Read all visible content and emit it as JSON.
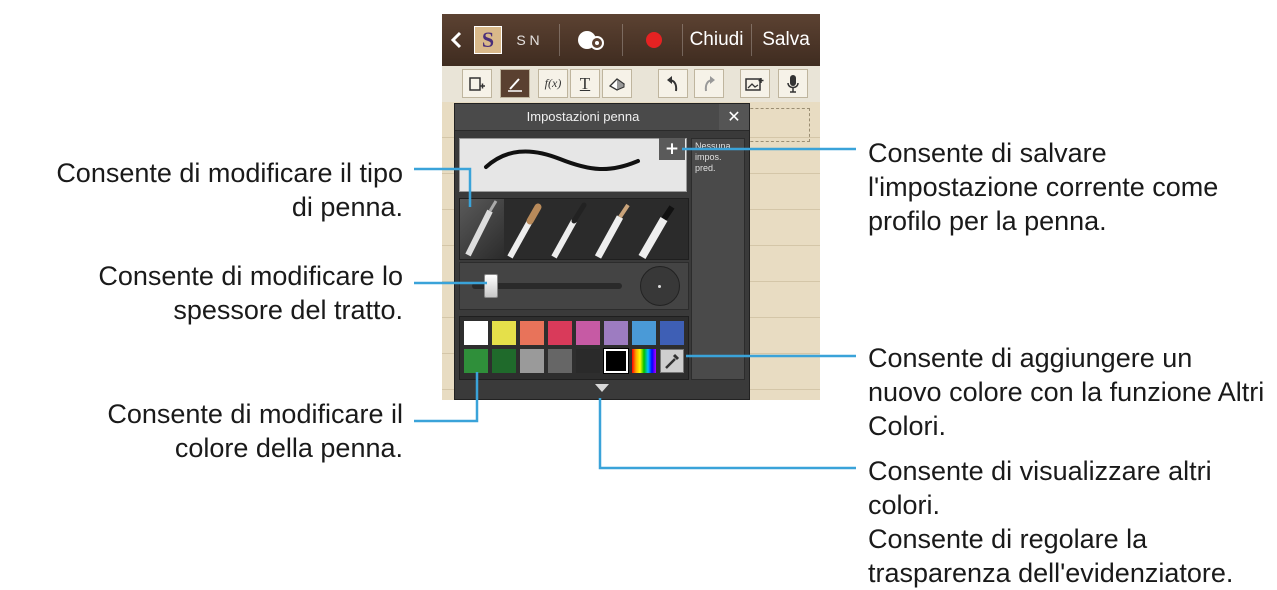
{
  "topbar": {
    "back_icon": "chevron-left-icon",
    "snote_label": "S N",
    "buttons": [
      "Chiudi",
      "Salva"
    ]
  },
  "toolbar": {
    "tools": [
      "add-page-icon",
      "pen-icon",
      "formula-icon",
      "text-icon",
      "eraser-icon",
      "undo-icon",
      "redo-icon",
      "insert-image-icon",
      "microphone-icon"
    ],
    "formula_label": "f(x)",
    "text_label": "T"
  },
  "pen_panel": {
    "title": "Impostazioni penna",
    "close_symbol": "✕",
    "add_preset_symbol": "+",
    "preset_placeholder": "Nessuna impos. pred.",
    "pen_types": [
      "fountain-pen",
      "brush",
      "brush-fine",
      "pencil",
      "marker"
    ],
    "thickness_percent": 8,
    "palette_row1": [
      "#ffffff",
      "#e5e04a",
      "#e8735a",
      "#d93a5a",
      "#c65aa4",
      "#9d7cc1",
      "#4a9ad7",
      "#3e5fb5"
    ],
    "palette_row2": [
      "#2f8f3a",
      "#1f6a2b",
      "#9a9a9a",
      "#666666",
      "#2a2a2a",
      "#000000"
    ],
    "selected_color": "#000000",
    "more_colors_icon": "eyedropper-icon"
  },
  "callouts": {
    "pen_type": "Consente di modificare il tipo di penna.",
    "thickness": "Consente di modificare lo spessore del tratto.",
    "pen_color": "Consente di modificare il colore della penna.",
    "save_profile": "Consente di salvare l'impostazione corrente come profilo per la penna.",
    "add_color": "Consente di aggiungere un nuovo colore con la funzione Altri Colori.",
    "more_colors_l1": "Consente di visualizzare altri colori.",
    "more_colors_l2": "Consente di regolare la trasparenza dell'evidenziatore."
  }
}
